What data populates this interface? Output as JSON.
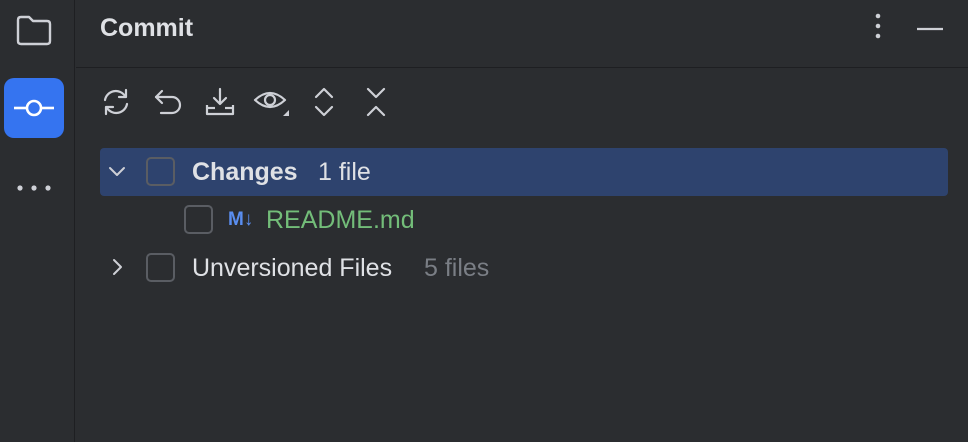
{
  "panel": {
    "title": "Commit"
  },
  "left_strip": {
    "items": [
      {
        "icon": "folder-icon",
        "active": false
      },
      {
        "icon": "commit-icon",
        "active": true
      },
      {
        "icon": "more-icon",
        "active": false
      }
    ]
  },
  "header_actions": [
    {
      "icon": "more-vertical-icon"
    },
    {
      "icon": "minimize-icon"
    }
  ],
  "toolbar": [
    {
      "icon": "refresh-icon"
    },
    {
      "icon": "rollback-icon"
    },
    {
      "icon": "shelve-icon"
    },
    {
      "icon": "eye-icon"
    },
    {
      "icon": "expand-all-icon"
    },
    {
      "icon": "collapse-all-icon"
    }
  ],
  "tree": {
    "changes": {
      "label": "Changes",
      "count": "1 file",
      "expanded": true,
      "files": [
        {
          "badge": "M↓",
          "name": "README.md"
        }
      ]
    },
    "unversioned": {
      "label": "Unversioned Files",
      "count": "5 files",
      "expanded": false
    }
  },
  "colors": {
    "background": "#2b2d30",
    "accent": "#3574f0",
    "selection": "#2e436e",
    "text": "#dfe1e5",
    "muted": "#7a7e85",
    "added_green": "#73bd79",
    "badge_blue": "#5a8ef0"
  }
}
